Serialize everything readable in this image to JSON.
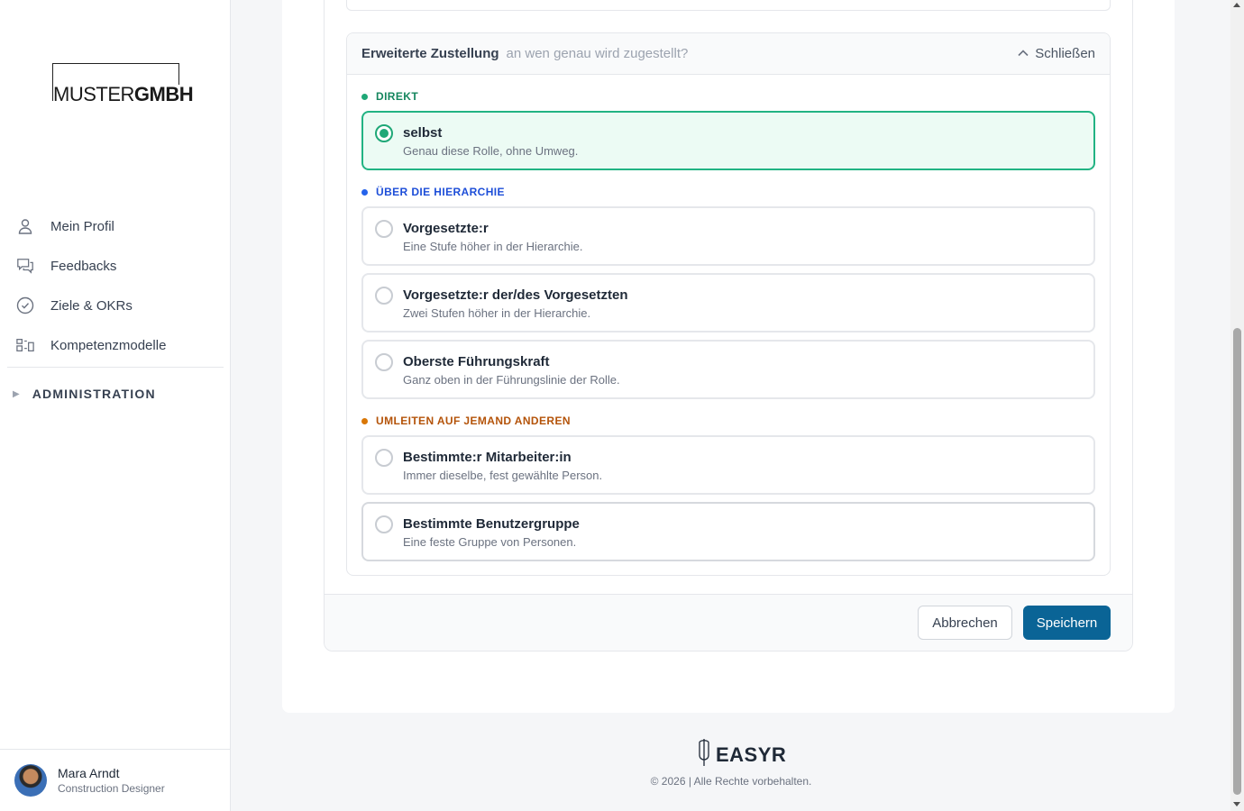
{
  "logo": {
    "light": "MUSTER",
    "bold": "GMBH"
  },
  "nav": {
    "items": [
      {
        "label": "Mein Profil",
        "icon": "user-icon"
      },
      {
        "label": "Feedbacks",
        "icon": "chat-bubbles-icon"
      },
      {
        "label": "Ziele & OKRs",
        "icon": "check-circle-icon"
      },
      {
        "label": "Kompetenzmodelle",
        "icon": "competency-grid-icon"
      }
    ],
    "admin_label": "ADMINISTRATION"
  },
  "user": {
    "name": "Mara Arndt",
    "role": "Construction Designer"
  },
  "section": {
    "title": "Erweiterte Zustellung",
    "subtitle": "an wen genau wird zugestellt?",
    "close_label": "Schließen"
  },
  "groups": {
    "direct": {
      "label": "DIREKT",
      "color": "#1fa877"
    },
    "hierarchy": {
      "label": "ÜBER DIE HIERARCHIE",
      "color": "#2563eb"
    },
    "redirect": {
      "label": "UMLEITEN AUF JEMAND ANDEREN",
      "color": "#d97706"
    }
  },
  "options": {
    "self": {
      "title": "selbst",
      "desc": "Genau diese Rolle, ohne Umweg.",
      "selected": true
    },
    "supervisor": {
      "title": "Vorgesetzte:r",
      "desc": "Eine Stufe höher in der Hierarchie.",
      "selected": false
    },
    "supervisor2": {
      "title": "Vorgesetzte:r der/des Vorgesetzten",
      "desc": "Zwei Stufen höher in der Hierarchie.",
      "selected": false
    },
    "top": {
      "title": "Oberste Führungskraft",
      "desc": "Ganz oben in der Führungslinie der Rolle.",
      "selected": false
    },
    "employee": {
      "title": "Bestimmte:r Mitarbeiter:in",
      "desc": "Immer dieselbe, fest gewählte Person.",
      "selected": false
    },
    "usergroup": {
      "title": "Bestimmte Benutzergruppe",
      "desc": "Eine feste Gruppe von Personen.",
      "selected": false
    }
  },
  "actions": {
    "cancel": "Abbrechen",
    "save": "Speichern"
  },
  "footer": {
    "brand": "EASYR",
    "copyright": "© 2026 | Alle Rechte vorbehalten."
  }
}
